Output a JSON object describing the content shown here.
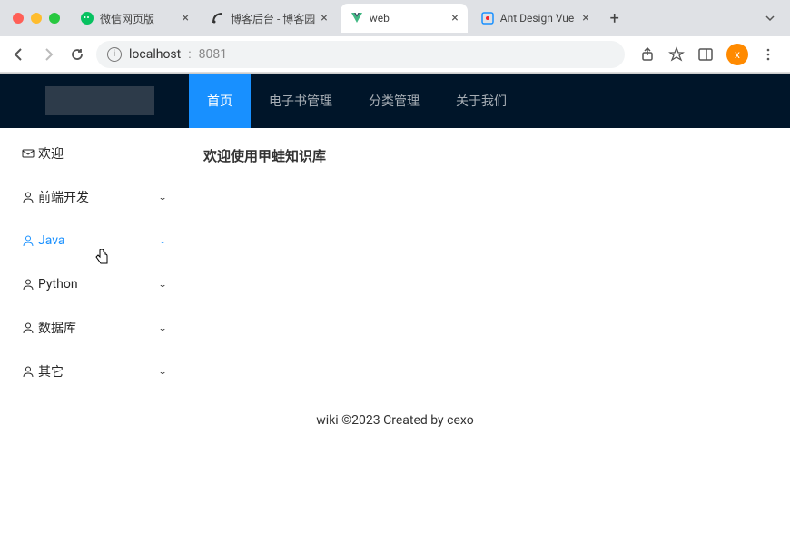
{
  "browser": {
    "tabs": [
      {
        "title": "微信网页版",
        "icon": "wechat",
        "active": false
      },
      {
        "title": "博客后台 - 博客园",
        "icon": "cnblogs",
        "active": false
      },
      {
        "title": "web",
        "icon": "vue",
        "active": true
      },
      {
        "title": "Ant Design Vue",
        "icon": "antd",
        "active": false
      }
    ],
    "address": {
      "host": "localhost",
      "port": "8081"
    },
    "avatar_letter": "x"
  },
  "header": {
    "nav": [
      {
        "label": "首页",
        "active": true
      },
      {
        "label": "电子书管理",
        "active": false
      },
      {
        "label": "分类管理",
        "active": false
      },
      {
        "label": "关于我们",
        "active": false
      }
    ]
  },
  "sidebar": {
    "items": [
      {
        "label": "欢迎",
        "icon": "mail",
        "expandable": false,
        "active": false
      },
      {
        "label": "前端开发",
        "icon": "user",
        "expandable": true,
        "active": false
      },
      {
        "label": "Java",
        "icon": "user",
        "expandable": true,
        "active": true
      },
      {
        "label": "Python",
        "icon": "user",
        "expandable": true,
        "active": false
      },
      {
        "label": "数据库",
        "icon": "user",
        "expandable": true,
        "active": false
      },
      {
        "label": "其它",
        "icon": "user",
        "expandable": true,
        "active": false
      }
    ]
  },
  "main": {
    "welcome_heading": "欢迎使用甲蛙知识库"
  },
  "footer": {
    "text": "wiki ©2023 Created by cexo"
  }
}
